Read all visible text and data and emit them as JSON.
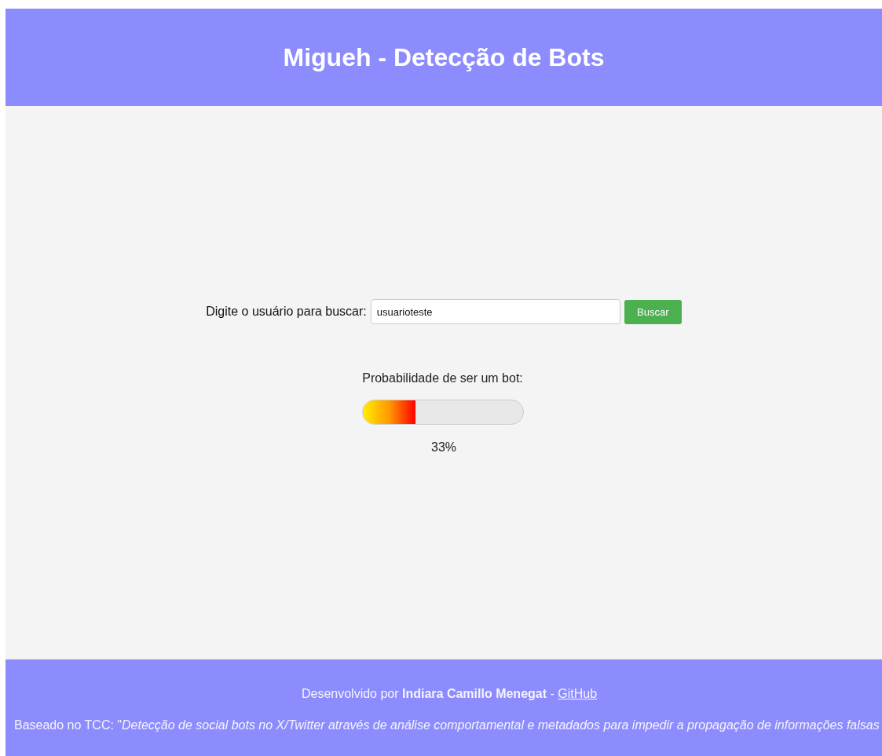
{
  "header": {
    "title": "Migueh - Detecção de Bots"
  },
  "search": {
    "label": "Digite o usuário para buscar:",
    "value": "usuarioteste",
    "button": "Buscar"
  },
  "result": {
    "label": "Probabilidade de ser um bot:",
    "level": 0.33,
    "reading": "33%"
  },
  "footer": {
    "credit": "Desenvolvido por **Indiara Camillo Menegat** - ",
    "link": "GitHub",
    "based_on": "Baseado no TCC: \"*Detecção de social bots no X/Twitter através de análise comportamental e metadados para impedir a propagação de informações falsas*"
  }
}
